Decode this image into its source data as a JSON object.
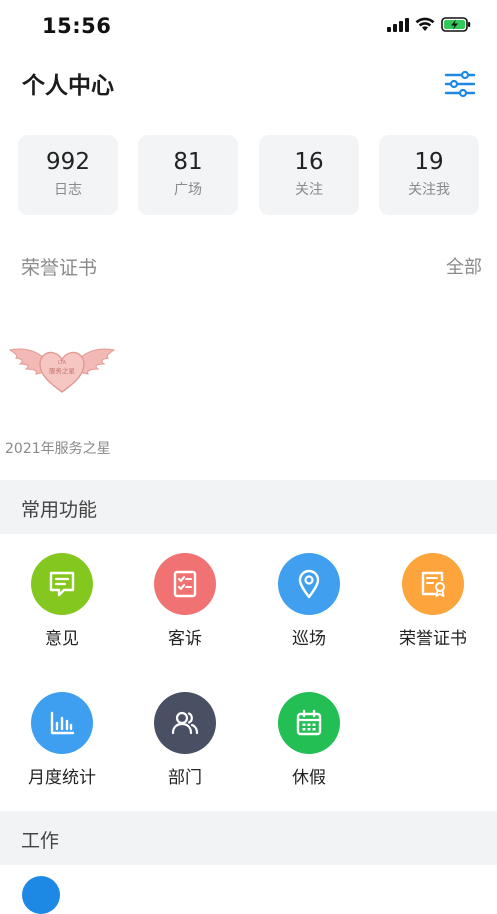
{
  "status_bar": {
    "time": "15:56"
  },
  "header": {
    "title": "个人中心"
  },
  "stats": [
    {
      "value": "992",
      "label": "日志"
    },
    {
      "value": "81",
      "label": "广场"
    },
    {
      "value": "16",
      "label": "关注"
    },
    {
      "value": "19",
      "label": "关注我"
    }
  ],
  "honor": {
    "title": "荣誉证书",
    "all_label": "全部",
    "badge_caption": "2021年服务之星",
    "badge_text": "服务之星"
  },
  "common_functions": {
    "title": "常用功能",
    "items": [
      {
        "label": "意见",
        "icon": "message-icon",
        "color": "#84c81f"
      },
      {
        "label": "客诉",
        "icon": "checklist-icon",
        "color": "#f07272"
      },
      {
        "label": "巡场",
        "icon": "location-pin-icon",
        "color": "#40a0ef"
      },
      {
        "label": "荣誉证书",
        "icon": "certificate-icon",
        "color": "#fda43c"
      },
      {
        "label": "月度统计",
        "icon": "bar-chart-icon",
        "color": "#3e9ff0"
      },
      {
        "label": "部门",
        "icon": "people-icon",
        "color": "#4a5064"
      },
      {
        "label": "休假",
        "icon": "calendar-icon",
        "color": "#23bf55"
      }
    ]
  },
  "work": {
    "title": "工作"
  },
  "colors": {
    "accent": "#1e88e5",
    "section_bg": "#f2f3f5",
    "card_bg": "#f3f4f6"
  }
}
